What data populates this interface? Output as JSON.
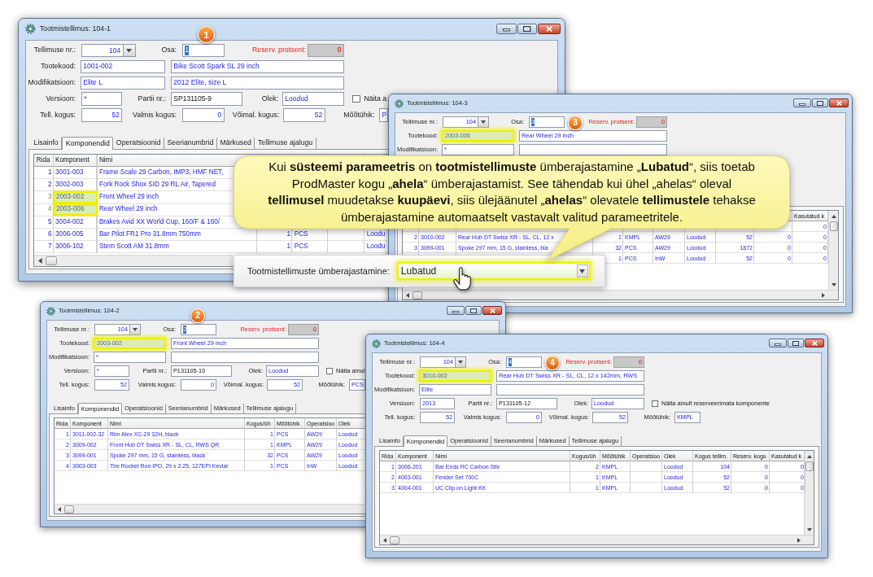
{
  "windows": [
    {
      "title": "Tootmistellimus: 104-1",
      "badge": "1",
      "form": {
        "order_no": {
          "kind": "combo",
          "label": "Tellimuse nr.:",
          "value": "104"
        },
        "part": {
          "kind": "text",
          "label": "Osa:",
          "value": "1",
          "text_selected": true
        },
        "reserve_percent": {
          "kind": "number",
          "label": "Reserv. protsent:",
          "value": "0",
          "disabled": true
        },
        "product_code": {
          "kind": "text",
          "label": "Tootekood:",
          "value": "1001-002",
          "highlighted": false
        },
        "product_name": {
          "kind": "text",
          "value": "Bike Scott Spark SL 29 inch"
        },
        "modification": {
          "kind": "text",
          "label": "Modifikatsioon:",
          "value": "Elite L"
        },
        "modification_name": {
          "kind": "text",
          "value": "2012 Elite, size L"
        },
        "version": {
          "kind": "text",
          "label": "Versioon:",
          "value": "*"
        },
        "batch_no": {
          "kind": "text",
          "label": "Partii nr.:",
          "value": "SP131105-9"
        },
        "status": {
          "kind": "text",
          "label": "Olek:",
          "value": "Loodud"
        },
        "unreserved_only": {
          "kind": "checkbox",
          "label": "Näita a",
          "checked": false
        },
        "ordered_qty": {
          "kind": "number",
          "label": "Tell. kogus:",
          "value": "52"
        },
        "finished_qty": {
          "kind": "number",
          "label": "Valmis kogus:",
          "value": "0"
        },
        "available_qty": {
          "kind": "number",
          "label": "Võimal. kogus:",
          "value": "52"
        },
        "unit": {
          "kind": "text",
          "label": "Mõõtühik:",
          "value": "P"
        }
      },
      "tabs": [
        {
          "label": "Lisainfo",
          "selected": false
        },
        {
          "label": "Komponendid",
          "selected": true
        },
        {
          "label": "Operatsioonid",
          "selected": false
        },
        {
          "label": "Seerianumbrid",
          "selected": false
        },
        {
          "label": "Märkused",
          "selected": false
        },
        {
          "label": "Tellimuse ajalugu",
          "selected": false
        }
      ],
      "table": {
        "header": {
          "rida": "Rida",
          "komponent": "Komponent",
          "nimi": "Nimi"
        },
        "rows": [
          {
            "rida": "1",
            "komponent": "3001-003",
            "nimi": "Frame Scale 29 Carbon, IMP3, HMF NET,",
            "highlighted": false
          },
          {
            "rida": "2",
            "komponent": "3002-003",
            "nimi": "Fork Rock Shox SID 29 RL Air, Tapered",
            "highlighted": false
          },
          {
            "rida": "3",
            "komponent": "2003-002",
            "nimi": "Front Wheel 29 inch",
            "highlighted": true
          },
          {
            "rida": "4",
            "komponent": "2003-006",
            "nimi": "Rear Wheel 29 inch",
            "highlighted": true
          },
          {
            "rida": "5",
            "komponent": "3004-002",
            "nimi": "Brakes Avid XX World Cup, 160/F & 160/",
            "highlighted": false
          },
          {
            "rida": "6",
            "komponent": "3006-005",
            "nimi": "Bar Pilot FR1 Pro 31.8mm 750mm",
            "kogus_uhik": "1",
            "mootuhik": "PCS",
            "olek": "Loodu",
            "highlighted": false
          },
          {
            "rida": "7",
            "komponent": "3006-102",
            "nimi": "Stem Scott AM 31.8mm",
            "kogus_uhik": "1",
            "mootuhik": "PCS",
            "olek": "Loodu",
            "highlighted": false
          }
        ]
      }
    },
    {
      "title": "Tootmistellimus: 104-3",
      "badge": "3",
      "form": {
        "order_no": {
          "kind": "combo",
          "label": "Tellimuse nr.:",
          "value": "104"
        },
        "part": {
          "kind": "text",
          "label": "Osa:",
          "value": "3",
          "text_selected": true
        },
        "reserve_percent": {
          "kind": "number",
          "label": "Reserv. protsent:",
          "value": "0",
          "disabled": true
        },
        "product_code": {
          "kind": "text",
          "label": "Tootekood:",
          "value": "2003-006",
          "highlighted": true
        },
        "product_name": {
          "kind": "text",
          "value": "Rear Wheel 29 inch"
        },
        "modification": {
          "kind": "text",
          "label": "Modifikatsioon:",
          "value": "*"
        },
        "modification_name": {
          "kind": "text"
        }
      },
      "table": {
        "header": {
          "kasutatud_kogus": "Kasutatud k"
        },
        "rows": [
          {
            "kasutatud_kogus": "0"
          },
          {
            "rida": "2",
            "komponent": "3010-002",
            "nimi": "Rear Hub DT Swiss XR - SL, CL, 12 x",
            "kogus_uhik": "1",
            "mootuhik": "KMPL",
            "operatsioon": "AW29",
            "olek": "Loodud",
            "kogus_tellim": "52",
            "reserv_kogus": "0",
            "kasutatud_kogus": "0"
          },
          {
            "rida": "3",
            "komponent": "3099-001",
            "nimi": "Spoke 297 mm, 15 G, stainless, bla",
            "kogus_uhik": "32",
            "mootuhik": "PCS",
            "operatsioon": "AW29",
            "olek": "Loodud",
            "kogus_tellim": "1872",
            "reserv_kogus": "0",
            "kasutatud_kogus": "0"
          },
          {
            "kogus_uhik": "1",
            "mootuhik": "PCS",
            "operatsioon": "InW",
            "olek": "Loodud",
            "kogus_tellim": "52",
            "reserv_kogus": "0",
            "kasutatud_kogus": "0"
          }
        ]
      }
    },
    {
      "title": "Tootmistellimus: 104-2",
      "badge": "2",
      "form": {
        "order_no": {
          "kind": "combo",
          "label": "Tellimuse nr.:",
          "value": "104"
        },
        "part": {
          "kind": "text",
          "label": "Osa:",
          "value": "2",
          "text_selected": true
        },
        "reserve_percent": {
          "kind": "number",
          "label": "Reserv. protsent:",
          "value": "0",
          "disabled": true
        },
        "product_code": {
          "kind": "text",
          "label": "Tootekood:",
          "value": "2003-002",
          "highlighted": true
        },
        "product_name": {
          "kind": "text",
          "value": "Front Wheel 29 inch"
        },
        "modification": {
          "kind": "text",
          "label": "Modifikatsioon:",
          "value": "*"
        },
        "modification_name": {
          "kind": "text"
        },
        "version": {
          "kind": "text",
          "label": "Versioon:",
          "value": "*"
        },
        "batch_no": {
          "kind": "text",
          "label": "Partii nr.:",
          "value": "P131105-10"
        },
        "status": {
          "kind": "text",
          "label": "Olek:",
          "value": "Loodud"
        },
        "unreserved_only": {
          "kind": "checkbox",
          "label": "Näita ainul",
          "checked": false
        },
        "ordered_qty": {
          "kind": "number",
          "label": "Tell. kogus:",
          "value": "52"
        },
        "finished_qty": {
          "kind": "number",
          "label": "Valmis kogus:",
          "value": "0"
        },
        "available_qty": {
          "kind": "number",
          "label": "Võimal. kogus:",
          "value": "52"
        },
        "unit": {
          "kind": "text",
          "label": "Mõõtühik:",
          "value": "PCS"
        }
      },
      "tabs": [
        {
          "label": "Lisainfo",
          "selected": false
        },
        {
          "label": "Komponendid",
          "selected": true
        },
        {
          "label": "Operatsioonid",
          "selected": false
        },
        {
          "label": "Seerianumbrid",
          "selected": false
        },
        {
          "label": "Märkused",
          "selected": false
        },
        {
          "label": "Tellimuse ajalugu",
          "selected": false
        }
      ],
      "table": {
        "header": {
          "rida": "Rida",
          "komponent": "Komponent",
          "nimi": "Nimi",
          "kogus_uhik": "Kogus/üh",
          "mootuhik": "Mõõtühik",
          "operatsioon": "Operatsioo",
          "olek": "Olek"
        },
        "rows": [
          {
            "rida": "1",
            "komponent": "3011-002-32",
            "nimi": "Rim Alex XC-29 32H, black",
            "kogus_uhik": "1",
            "mootuhik": "PCS",
            "operatsioon": "AW29",
            "olek": "Loodud"
          },
          {
            "rida": "2",
            "komponent": "3009-002",
            "nimi": "Front Hub DT Swiss XR - SL, CL, RWS QR",
            "kogus_uhik": "1",
            "mootuhik": "KMPL",
            "operatsioon": "AW29",
            "olek": "Loodud"
          },
          {
            "rida": "3",
            "komponent": "3099-001",
            "nimi": "Spoke 297 mm, 15 G, stainless, black",
            "kogus_uhik": "32",
            "mootuhik": "PCS",
            "operatsioon": "AW29",
            "olek": "Loodud"
          },
          {
            "rida": "4",
            "komponent": "3003-003",
            "nimi": "Tire Rocket Ron IPO, 29 x 2.25, 127EPI Kevlar",
            "kogus_uhik": "1",
            "mootuhik": "PCS",
            "operatsioon": "InW",
            "olek": "Loodud"
          }
        ]
      }
    },
    {
      "title": "Tootmistellimus: 104-4",
      "badge": "4",
      "form": {
        "order_no": {
          "kind": "combo",
          "label": "Tellimuse nr.:",
          "value": "104"
        },
        "part": {
          "kind": "text",
          "label": "Osa:",
          "value": "4",
          "text_selected": true
        },
        "reserve_percent": {
          "kind": "number",
          "label": "Reserv. protsent:",
          "value": "0",
          "disabled": true
        },
        "product_code": {
          "kind": "text",
          "label": "Tootekood:",
          "value": "3010-002",
          "highlighted": true
        },
        "product_name": {
          "kind": "text",
          "value": "Rear Hub DT Swiss XR - SL, CL, 12 x 142mm, RWS"
        },
        "modification": {
          "kind": "text",
          "label": "Modifikatsioon:",
          "value": "Elite"
        },
        "modification_name": {
          "kind": "text"
        },
        "version": {
          "kind": "text",
          "label": "Versioon:",
          "value": "2013"
        },
        "batch_no": {
          "kind": "text",
          "label": "Partii nr.:",
          "value": "P131105-12"
        },
        "status": {
          "kind": "text",
          "label": "Olek:",
          "value": "Loodud"
        },
        "unreserved_only": {
          "kind": "checkbox",
          "label": "Näita ainult reserveerimata komponente",
          "checked": false
        },
        "ordered_qty": {
          "kind": "number",
          "label": "Tell. kogus:",
          "value": "52"
        },
        "finished_qty": {
          "kind": "number",
          "label": "Valmis kogus:",
          "value": "0"
        },
        "available_qty": {
          "kind": "number",
          "label": "Võimal. kogus:",
          "value": "52"
        },
        "unit": {
          "kind": "text",
          "label": "Mõõtühik:",
          "value": "KMPL"
        }
      },
      "tabs": [
        {
          "label": "Lisainfo",
          "selected": false
        },
        {
          "label": "Komponendid",
          "selected": true
        },
        {
          "label": "Operatsioonid",
          "selected": false
        },
        {
          "label": "Seerianumbrid",
          "selected": false
        },
        {
          "label": "Märkused",
          "selected": false
        },
        {
          "label": "Tellimuse ajalugu",
          "selected": false
        }
      ],
      "table": {
        "header": {
          "rida": "Rida",
          "komponent": "Komponent",
          "nimi": "Nimi",
          "kogus_uhik": "Kogus/üh",
          "mootuhik": "Mõõtühik",
          "operatsioon": "Operatsioo",
          "olek": "Olek",
          "kogus_tellim": "Kogus tellim.",
          "reserv_kogus": "Reserv. kogu",
          "kasutatud_kogus": "Kasutatud k"
        },
        "rows": [
          {
            "rida": "1",
            "komponent": "3006-201",
            "nimi": "Bar Ends RC Carbon Stix",
            "kogus_uhik": "2",
            "mootuhik": "KMPL",
            "olek": "Loodud",
            "kogus_tellim": "104",
            "reserv_kogus": "0",
            "kasutatud_kogus": "0"
          },
          {
            "rida": "2",
            "komponent": "4003-001",
            "nimi": "Fender Set 700C",
            "kogus_uhik": "1",
            "mootuhik": "KMPL",
            "olek": "Loodud",
            "kogus_tellim": "52",
            "reserv_kogus": "0",
            "kasutatud_kogus": "0"
          },
          {
            "rida": "3",
            "komponent": "4004-001",
            "nimi": "UC Clip on Light Kit",
            "kogus_uhik": "1",
            "mootuhik": "KMPL",
            "olek": "Loodud",
            "kogus_tellim": "52",
            "reserv_kogus": "0",
            "kasutatud_kogus": "0"
          }
        ]
      }
    }
  ],
  "callout": {
    "text": "Kui **süsteemi parameetris** on **tootmistellimuste** ümberajastamine „**Lubatud**“, siis toetab\nProdMaster kogu „**ahela**“ ümberajastamist. See tähendab kui ühel „ahelas“ oleval\n**tellimusel** muudetakse **kuupäevi**, siis ülejäänutel „**ahelas**“ olevatele **tellimustele** tehakse\nümberajastamine automaatselt vastavalt valitud parameetritele."
  },
  "setting": {
    "label": "Tootmistellimuste ümberajastamine:",
    "value": "Lubatud",
    "highlighted": true
  }
}
